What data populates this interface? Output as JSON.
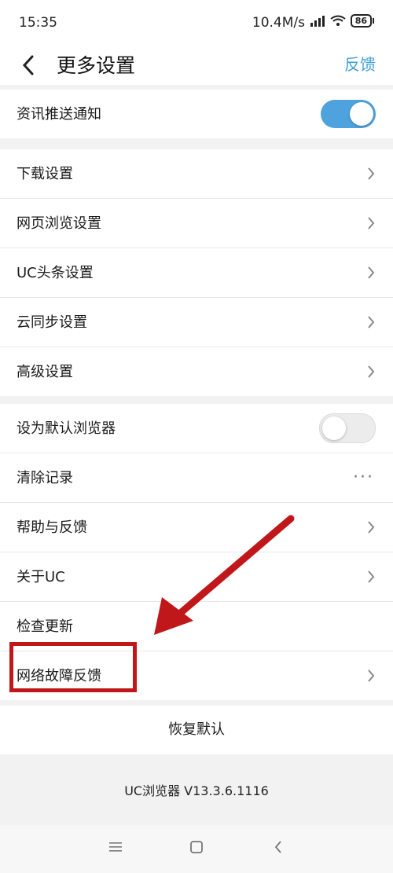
{
  "status_bar": {
    "time": "15:35",
    "speed": "10.4M/s",
    "battery": "86"
  },
  "header": {
    "title": "更多设置",
    "feedback": "反馈"
  },
  "section1": {
    "items": [
      {
        "label": "资讯推送通知",
        "toggle": "on"
      }
    ]
  },
  "section2": {
    "items": [
      {
        "label": "下载设置"
      },
      {
        "label": "网页浏览设置"
      },
      {
        "label": "UC头条设置"
      },
      {
        "label": "云同步设置"
      },
      {
        "label": "高级设置"
      }
    ]
  },
  "section3": {
    "items": [
      {
        "label": "设为默认浏览器",
        "toggle": "off"
      },
      {
        "label": "清除记录",
        "trailing": "···"
      },
      {
        "label": "帮助与反馈"
      },
      {
        "label": "关于UC"
      },
      {
        "label": "检查更新"
      },
      {
        "label": "网络故障反馈"
      }
    ]
  },
  "restore_label": "恢复默认",
  "version": "UC浏览器 V13.3.6.1116",
  "colors": {
    "accent": "#4ea2de",
    "annotation": "#c0181a",
    "link": "#3f9ed8"
  },
  "icons": [
    "wifi-icon",
    "signal-icon",
    "battery-icon",
    "back-icon",
    "chevron-right-icon",
    "more-dots-icon",
    "menu-icon",
    "home-icon",
    "nav-back-icon"
  ]
}
